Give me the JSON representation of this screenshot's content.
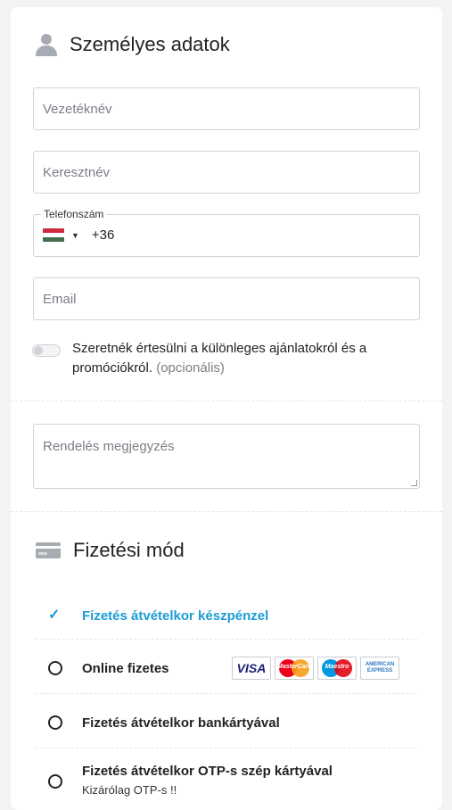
{
  "personal": {
    "title": "Személyes adatok",
    "icon": "user-icon",
    "last_name_placeholder": "Vezetéknév",
    "first_name_placeholder": "Keresztnév",
    "phone_label": "Telefonszám",
    "phone_prefix": "+36",
    "phone_country_icon": "hungary-flag-icon",
    "email_placeholder": "Email",
    "consent_text": "Szeretnék értesülni a különleges ajánlatokról és a promóciókról.",
    "consent_optional": "(opcionális)",
    "consent_on": false
  },
  "note": {
    "placeholder": "Rendelés megjegyzés"
  },
  "payment": {
    "title": "Fizetési mód",
    "icon": "credit-card-icon",
    "options": [
      {
        "label": "Fizetés átvételkor készpénzel",
        "selected": true
      },
      {
        "label": "Online fizetes",
        "selected": false,
        "cards": [
          "VISA",
          "MasterCard",
          "Maestro",
          "AMERICAN EXPRESS"
        ]
      },
      {
        "label": "Fizetés átvételkor bankártyával",
        "selected": false
      },
      {
        "label": "Fizetés átvételkor OTP-s szép kártyával",
        "sublabel": "Kizárólag OTP-s !!",
        "selected": false
      }
    ]
  },
  "colors": {
    "accent": "#1a9bd7",
    "border": "#cfd3d8",
    "placeholder": "#7a7f86",
    "flag_red": "#cd2a3e",
    "flag_white": "#ffffff",
    "flag_green": "#436f4d"
  }
}
